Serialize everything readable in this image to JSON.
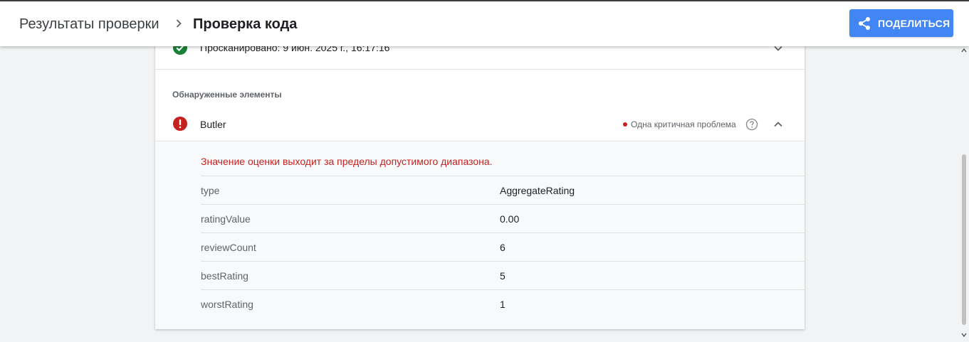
{
  "header": {
    "breadcrumb_root": "Результаты проверки",
    "breadcrumb_current": "Проверка кода",
    "share_label": "ПОДЕЛИТЬСЯ"
  },
  "scan": {
    "text": "Просканировано: 9 июн. 2025 г., 16:17:16"
  },
  "detected": {
    "section_title": "Обнаруженные элементы",
    "item": {
      "name": "Butler",
      "issue_text": "Одна критичная проблема",
      "error_message": "Значение оценки выходит за пределы допустимого диапазона.",
      "properties": [
        {
          "name": "type",
          "value": "AggregateRating"
        },
        {
          "name": "ratingValue",
          "value": "0.00"
        },
        {
          "name": "reviewCount",
          "value": "6"
        },
        {
          "name": "bestRating",
          "value": "5"
        },
        {
          "name": "worstRating",
          "value": "1"
        }
      ]
    }
  },
  "colors": {
    "accent": "#4285f4",
    "error": "#c5221f",
    "success": "#188038"
  },
  "icons": {
    "share": "share-icon",
    "scan_status": "check-circle-icon",
    "item_status": "error-circle-icon",
    "help": "help-circle-icon"
  }
}
